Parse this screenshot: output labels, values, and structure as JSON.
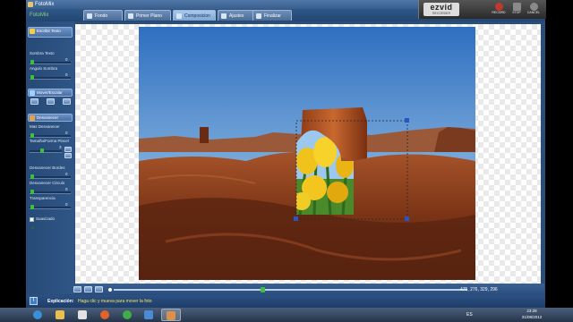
{
  "window": {
    "title": "FotoMix",
    "brand": "FotoMix"
  },
  "tabs": [
    {
      "label": "Fondo",
      "active": false
    },
    {
      "label": "Primer Plano",
      "active": false
    },
    {
      "label": "Composicion",
      "active": true
    },
    {
      "label": "Ajustes",
      "active": false
    },
    {
      "label": "Finalizar",
      "active": false
    }
  ],
  "recorder": {
    "logo": "ezvid",
    "logo_sub": "RECORDER",
    "buttons": [
      {
        "label": "RECORD",
        "icon": "record-icon",
        "color": "#c0392b"
      },
      {
        "label": "STOP",
        "icon": "stop-icon",
        "color": "#8a8a8a"
      },
      {
        "label": "CANCEL",
        "icon": "cancel-icon",
        "color": "#8a8a8a"
      }
    ]
  },
  "panel": {
    "text_section": {
      "label": "Escribir Texto"
    },
    "sliders_top": [
      {
        "label": "Sombra Texto",
        "value": "0",
        "level": 0.05
      },
      {
        "label": "Angulo Sombra",
        "value": "0",
        "level": 0.05
      }
    ],
    "move_section": {
      "label": "Mover/Escalar"
    },
    "fade_section": {
      "label": "Desvanecer"
    },
    "sliders_fade": [
      {
        "label": "Mas Desvanecer",
        "value": "0",
        "level": 0.05
      },
      {
        "label": "Tamaño/Forma Pincel",
        "value": "3",
        "level": 0.35
      },
      {
        "label": "Desvanecer Bordes",
        "value": "0",
        "level": 0.05
      },
      {
        "label": "Desvanecer Circulo",
        "value": "0",
        "level": 0.05
      },
      {
        "label": "Transparencia",
        "value": "0",
        "level": 0.05
      }
    ],
    "smooth": {
      "label": "Suavizado",
      "checked": true
    }
  },
  "canvas": {
    "coords": "475, 276, 329, 296",
    "zoom_level": 0.42
  },
  "status": {
    "label": "Explicación:",
    "message": "Haga clic y mueva para mover la foto"
  },
  "taskbar": {
    "apps": [
      {
        "icon": "start-orb-icon",
        "color": "#3a8fd9"
      },
      {
        "icon": "explorer-icon",
        "color": "#e7c04f"
      },
      {
        "icon": "media-player-icon",
        "color": "#e2e2e2"
      },
      {
        "icon": "firefox-icon",
        "color": "#e2632a"
      },
      {
        "icon": "chrome-icon",
        "color": "#3fae49"
      },
      {
        "icon": "vlc-like-icon",
        "color": "#4a8bd6"
      },
      {
        "icon": "fotomix-icon",
        "color": "#d99150"
      }
    ],
    "language": "ES",
    "time": "23:28",
    "date": "31/08/2012"
  }
}
